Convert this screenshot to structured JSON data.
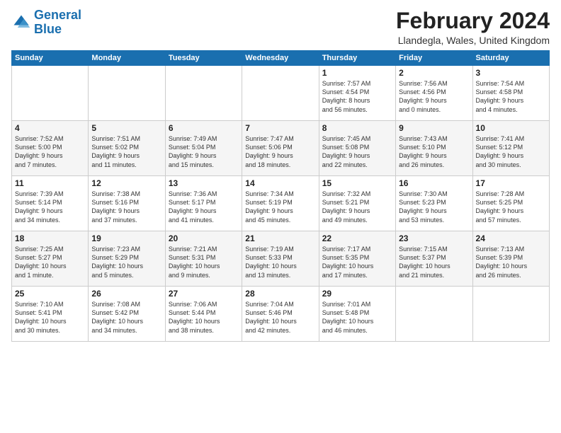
{
  "logo": {
    "text_general": "General",
    "text_blue": "Blue"
  },
  "header": {
    "month_year": "February 2024",
    "location": "Llandegla, Wales, United Kingdom"
  },
  "days_of_week": [
    "Sunday",
    "Monday",
    "Tuesday",
    "Wednesday",
    "Thursday",
    "Friday",
    "Saturday"
  ],
  "weeks": [
    [
      {
        "day": "",
        "content": ""
      },
      {
        "day": "",
        "content": ""
      },
      {
        "day": "",
        "content": ""
      },
      {
        "day": "",
        "content": ""
      },
      {
        "day": "1",
        "content": "Sunrise: 7:57 AM\nSunset: 4:54 PM\nDaylight: 8 hours\nand 56 minutes."
      },
      {
        "day": "2",
        "content": "Sunrise: 7:56 AM\nSunset: 4:56 PM\nDaylight: 9 hours\nand 0 minutes."
      },
      {
        "day": "3",
        "content": "Sunrise: 7:54 AM\nSunset: 4:58 PM\nDaylight: 9 hours\nand 4 minutes."
      }
    ],
    [
      {
        "day": "4",
        "content": "Sunrise: 7:52 AM\nSunset: 5:00 PM\nDaylight: 9 hours\nand 7 minutes."
      },
      {
        "day": "5",
        "content": "Sunrise: 7:51 AM\nSunset: 5:02 PM\nDaylight: 9 hours\nand 11 minutes."
      },
      {
        "day": "6",
        "content": "Sunrise: 7:49 AM\nSunset: 5:04 PM\nDaylight: 9 hours\nand 15 minutes."
      },
      {
        "day": "7",
        "content": "Sunrise: 7:47 AM\nSunset: 5:06 PM\nDaylight: 9 hours\nand 18 minutes."
      },
      {
        "day": "8",
        "content": "Sunrise: 7:45 AM\nSunset: 5:08 PM\nDaylight: 9 hours\nand 22 minutes."
      },
      {
        "day": "9",
        "content": "Sunrise: 7:43 AM\nSunset: 5:10 PM\nDaylight: 9 hours\nand 26 minutes."
      },
      {
        "day": "10",
        "content": "Sunrise: 7:41 AM\nSunset: 5:12 PM\nDaylight: 9 hours\nand 30 minutes."
      }
    ],
    [
      {
        "day": "11",
        "content": "Sunrise: 7:39 AM\nSunset: 5:14 PM\nDaylight: 9 hours\nand 34 minutes."
      },
      {
        "day": "12",
        "content": "Sunrise: 7:38 AM\nSunset: 5:16 PM\nDaylight: 9 hours\nand 37 minutes."
      },
      {
        "day": "13",
        "content": "Sunrise: 7:36 AM\nSunset: 5:17 PM\nDaylight: 9 hours\nand 41 minutes."
      },
      {
        "day": "14",
        "content": "Sunrise: 7:34 AM\nSunset: 5:19 PM\nDaylight: 9 hours\nand 45 minutes."
      },
      {
        "day": "15",
        "content": "Sunrise: 7:32 AM\nSunset: 5:21 PM\nDaylight: 9 hours\nand 49 minutes."
      },
      {
        "day": "16",
        "content": "Sunrise: 7:30 AM\nSunset: 5:23 PM\nDaylight: 9 hours\nand 53 minutes."
      },
      {
        "day": "17",
        "content": "Sunrise: 7:28 AM\nSunset: 5:25 PM\nDaylight: 9 hours\nand 57 minutes."
      }
    ],
    [
      {
        "day": "18",
        "content": "Sunrise: 7:25 AM\nSunset: 5:27 PM\nDaylight: 10 hours\nand 1 minute."
      },
      {
        "day": "19",
        "content": "Sunrise: 7:23 AM\nSunset: 5:29 PM\nDaylight: 10 hours\nand 5 minutes."
      },
      {
        "day": "20",
        "content": "Sunrise: 7:21 AM\nSunset: 5:31 PM\nDaylight: 10 hours\nand 9 minutes."
      },
      {
        "day": "21",
        "content": "Sunrise: 7:19 AM\nSunset: 5:33 PM\nDaylight: 10 hours\nand 13 minutes."
      },
      {
        "day": "22",
        "content": "Sunrise: 7:17 AM\nSunset: 5:35 PM\nDaylight: 10 hours\nand 17 minutes."
      },
      {
        "day": "23",
        "content": "Sunrise: 7:15 AM\nSunset: 5:37 PM\nDaylight: 10 hours\nand 21 minutes."
      },
      {
        "day": "24",
        "content": "Sunrise: 7:13 AM\nSunset: 5:39 PM\nDaylight: 10 hours\nand 26 minutes."
      }
    ],
    [
      {
        "day": "25",
        "content": "Sunrise: 7:10 AM\nSunset: 5:41 PM\nDaylight: 10 hours\nand 30 minutes."
      },
      {
        "day": "26",
        "content": "Sunrise: 7:08 AM\nSunset: 5:42 PM\nDaylight: 10 hours\nand 34 minutes."
      },
      {
        "day": "27",
        "content": "Sunrise: 7:06 AM\nSunset: 5:44 PM\nDaylight: 10 hours\nand 38 minutes."
      },
      {
        "day": "28",
        "content": "Sunrise: 7:04 AM\nSunset: 5:46 PM\nDaylight: 10 hours\nand 42 minutes."
      },
      {
        "day": "29",
        "content": "Sunrise: 7:01 AM\nSunset: 5:48 PM\nDaylight: 10 hours\nand 46 minutes."
      },
      {
        "day": "",
        "content": ""
      },
      {
        "day": "",
        "content": ""
      }
    ]
  ]
}
